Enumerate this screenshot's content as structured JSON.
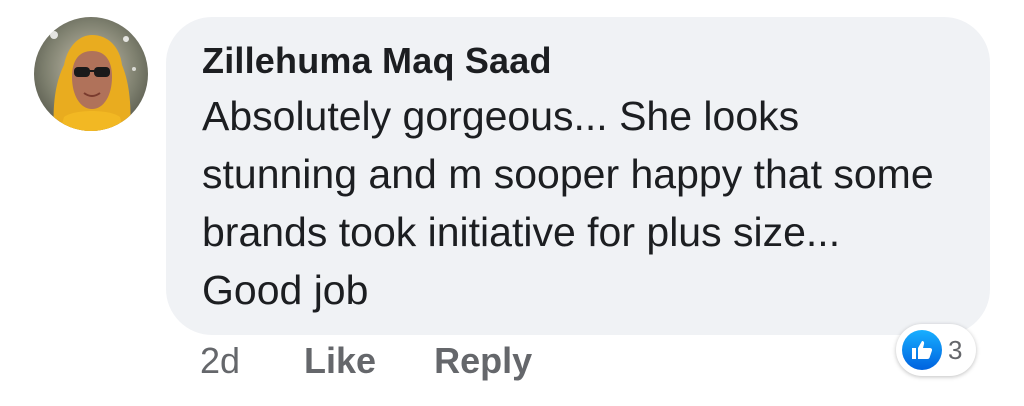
{
  "comment": {
    "author": "Zillehuma Maq Saad",
    "text": "Absolutely gorgeous... She looks stunning and m sooper happy that some brands took initiative for plus size... Good job",
    "timestamp": "2d",
    "like_label": "Like",
    "reply_label": "Reply",
    "reaction_icon": "thumbs-up-icon",
    "reaction_count": "3",
    "avatar_icon": "profile-photo"
  },
  "colors": {
    "bubble_bg": "#f0f2f5",
    "text": "#1c1e21",
    "secondary_text": "#65676b",
    "like_blue": "#1877f2"
  }
}
